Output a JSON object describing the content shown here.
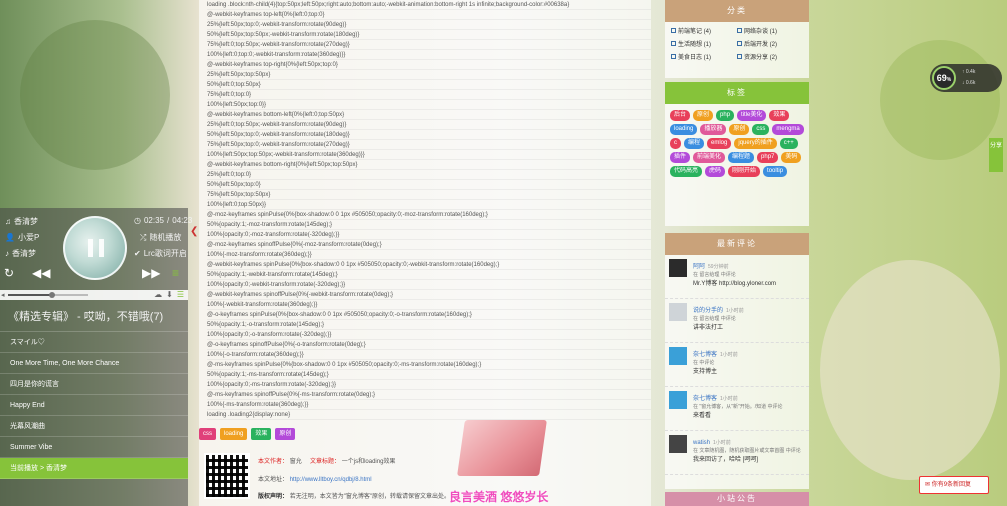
{
  "player": {
    "song_title": "香清梦",
    "artist": "小爱P",
    "album": "香清梦",
    "time_current": "02:35",
    "time_total": "04:23",
    "random_label": "随机播放",
    "lyric_label": "Lrc歌词开启",
    "progress_fraction": 0.55,
    "album_header": "《精选专辑》 - 哎呦，不错哦(7)",
    "tracks": [
      "スマイル♡",
      "One More Time, One More Chance",
      "四月是你的谎言",
      "Happy End",
      "光幕风潮曲",
      "Summer Vibe",
      "当前播放 > 香清梦"
    ]
  },
  "article": {
    "code_lines": [
      "loading .block:nth-child(4){top:50px;left:50px;right:auto;bottom:auto;-webkit-animation:bottom-right 1s infinite;background-color:#00638a}",
      "@-webkit-keyframes top-left{0%{left:0;top:0}",
      "25%{left:50px;top:0;-webkit-transform:rotate(90deg)}",
      "50%{left:50px;top:50px;-webkit-transform:rotate(180deg)}",
      "75%{left:0;top:50px;-webkit-transform:rotate(270deg)}",
      "100%{left:0;top:0;-webkit-transform:rotate(360deg)}}",
      "@-webkit-keyframes top-right{0%{left:50px;top:0}",
      "25%{left:50px;top:50px}",
      "50%{left:0;top:50px}",
      "75%{left:0;top:0}",
      "100%{left:50px;top:0}}",
      "@-webkit-keyframes bottom-left{0%{left:0;top:50px}",
      "25%{left:0;top:50px;-webkit-transform:rotate(90deg)}",
      "50%{left:50px;top:0;-webkit-transform:rotate(180deg)}",
      "75%{left:50px;top:0;-webkit-transform:rotate(270deg)}",
      "100%{left:50px;top:50px;-webkit-transform:rotate(360deg)}}",
      "@-webkit-keyframes bottom-right{0%{left:50px;top:50px}",
      "25%{left:0;top:0}",
      "50%{left:50px;top:0}",
      "75%{left:50px;top:50px}",
      "100%{left:0;top:50px}}",
      "@-moz-keyframes spinPulse{0%{box-shadow:0 0 1px #505050;opacity:0;-moz-transform:rotate(160deg);}",
      "50%{opacity:1;-moz-transform:rotate(145deg);}",
      "100%{opacity:0;-moz-transform:rotate(-320deg);}}",
      "@-moz-keyframes spinoffPulse{0%{-moz-transform:rotate(0deg);}",
      "100%{-moz-transform:rotate(360deg);}}",
      "@-webkit-keyframes spinPulse{0%{box-shadow:0 0 1px #505050;opacity:0;-webkit-transform:rotate(160deg);}",
      "50%{opacity:1;-webkit-transform:rotate(145deg);}",
      "100%{opacity:0;-webkit-transform:rotate(-320deg);}}",
      "@-webkit-keyframes spinoffPulse{0%{-webkit-transform:rotate(0deg);}",
      "100%{-webkit-transform:rotate(360deg);}}",
      "@-o-keyframes spinPulse{0%{box-shadow:0 0 1px #505050;opacity:0;-o-transform:rotate(160deg);}",
      "50%{opacity:1;-o-transform:rotate(145deg);}",
      "100%{opacity:0;-o-transform:rotate(-320deg);}}",
      "@-o-keyframes spinoffPulse{0%{-o-transform:rotate(0deg);}",
      "100%{-o-transform:rotate(360deg);}}",
      "@-ms-keyframes spinPulse{0%{box-shadow:0 0 1px #505050;opacity:0;-ms-transform:rotate(160deg);}",
      "50%{opacity:1;-ms-transform:rotate(145deg);}",
      "100%{opacity:0;-ms-transform:rotate(-320deg);}}",
      "@-ms-keyframes spinoffPulse{0%{-ms-transform:rotate(0deg);}",
      "100%{-ms-transform:rotate(360deg);}}",
      "loading .loading2{display:none}"
    ],
    "tags": [
      {
        "label": "css",
        "color": "#e0407a"
      },
      {
        "label": "loading",
        "color": "#f0a020"
      },
      {
        "label": "效果",
        "color": "#2ab25e"
      },
      {
        "label": "原创",
        "color": "#b34ad9"
      }
    ],
    "author_label": "本文作者：",
    "author": "窗允",
    "title_label": "文章标题：",
    "title": "一个js和loading效果",
    "url_label": "本文地址：",
    "url": "http://www.lltboy.cn/qdbj/8.html",
    "copyright_label": "版权声明：",
    "copyright": "若无注明，本文皆为\"窗允博客\"原创，转载请保留文章出处。",
    "slogan": "良言美酒 悠悠岁长"
  },
  "sidebar": {
    "categories_title": "分类",
    "categories": [
      "前端笔记 (4)",
      "网络杂谈 (1)",
      "生活随想 (1)",
      "后端开发 (2)",
      "美食日志 (1)",
      "资源分享 (2)"
    ],
    "tags_title": "标签",
    "tags": [
      {
        "label": "后台",
        "color": "#e8405a"
      },
      {
        "label": "原创",
        "color": "#f0a020"
      },
      {
        "label": "php",
        "color": "#2ab25e"
      },
      {
        "label": "title美化",
        "color": "#b34ad9"
      },
      {
        "label": "效果",
        "color": "#e8405a"
      },
      {
        "label": "loading",
        "color": "#3a8ee0"
      },
      {
        "label": "播放器",
        "color": "#e05a9a"
      },
      {
        "label": "原创",
        "color": "#f0a020"
      },
      {
        "label": "css",
        "color": "#2ab25e"
      },
      {
        "label": "mengma",
        "color": "#b34ad9"
      },
      {
        "label": "c",
        "color": "#e8405a"
      },
      {
        "label": "编程",
        "color": "#3a8ee0"
      },
      {
        "label": "emlog",
        "color": "#e8405a"
      },
      {
        "label": "jquery的插件",
        "color": "#f0a020"
      },
      {
        "label": "c++",
        "color": "#2ab25e"
      },
      {
        "label": "插件",
        "color": "#b34ad9"
      },
      {
        "label": "前端美化",
        "color": "#e05a9a"
      },
      {
        "label": "编程题",
        "color": "#3a8ee0"
      },
      {
        "label": "php7",
        "color": "#e8405a"
      },
      {
        "label": "美码",
        "color": "#f0a020"
      },
      {
        "label": "代码高亮",
        "color": "#2ab25e"
      },
      {
        "label": "虎码",
        "color": "#b34ad9"
      },
      {
        "label": "刚刚开始",
        "color": "#e8405a"
      },
      {
        "label": "tooltip",
        "color": "#3a8ee0"
      }
    ],
    "comments_title": "最新评论",
    "comments": [
      {
        "name": "阿阿",
        "time": "59分钟前",
        "meta": "在 留言给理 中评论",
        "text": "Mr.Y博客 http://blog.yloner.com",
        "avatar_color": "#2b2b2b"
      },
      {
        "name": "说的分手的",
        "time": "1小时前",
        "meta": "在 留言给理 中评论",
        "text": "讲非法打工",
        "avatar_color": "#cfd4d8"
      },
      {
        "name": "奈七博客",
        "time": "1小时前",
        "meta": "在 中评论",
        "text": "支持博主",
        "avatar_color": "#3aa0d8"
      },
      {
        "name": "奈七博客",
        "time": "1小时前",
        "meta": "在 \"窗允博客，从\"新\"开始。/知道 中评论",
        "text": "来看看",
        "avatar_color": "#3aa0d8"
      },
      {
        "name": "watish",
        "time": "1小时前",
        "meta": "在 文章随机图，随机获取图片或文章首图 中评论",
        "text": "我来回访了，哈哈 [呵呵]",
        "avatar_color": "#444444"
      }
    ],
    "bottom_title": "小站公告"
  },
  "widgets": {
    "gauge_value": "69",
    "gauge_unit": "%",
    "gauge_line1": "0.4k",
    "gauge_line2": "0.6k",
    "share_label": "分享",
    "toast_text": "你有9条新回复"
  },
  "colors": {
    "accent_green": "#86c33a",
    "panel_brown": "#c9a27a",
    "panel_green": "#86c33a",
    "panel_pink": "#d68fa8"
  }
}
